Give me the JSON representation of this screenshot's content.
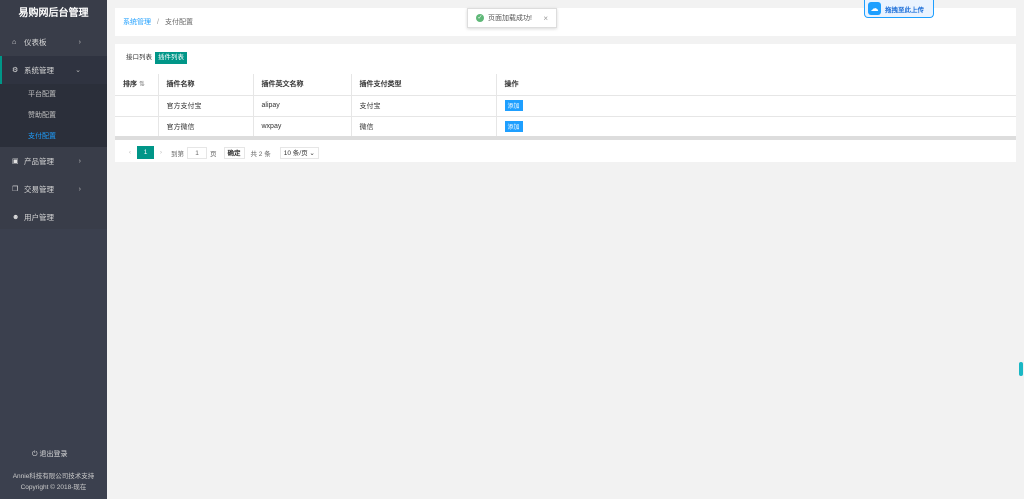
{
  "sidebar": {
    "brand": "易购网后台管理",
    "items": [
      {
        "label": "仪表板",
        "icon": "home-icon"
      },
      {
        "label": "系统管理",
        "icon": "gear-icon"
      },
      {
        "label": "产品管理",
        "icon": "product-icon"
      },
      {
        "label": "交易管理",
        "icon": "copy-icon"
      },
      {
        "label": "用户管理",
        "icon": "users-icon"
      }
    ],
    "submenu": [
      "平台配置",
      "赞助配置",
      "支付配置"
    ],
    "logout": "退出登录",
    "support": "Annie科技有限公司技术支持",
    "copyright": "Copyright © 2018-现在"
  },
  "breadcrumb": {
    "parent": "系统管理",
    "separator": "/",
    "current": "支付配置"
  },
  "toast": {
    "message": "页面加载成功!",
    "close": "×"
  },
  "upload": {
    "label": "拖拽至此上传"
  },
  "tabs": {
    "interface": "接口列表",
    "plugin": "插件列表"
  },
  "table": {
    "headers": {
      "sort": "排序",
      "name": "插件名称",
      "en": "插件英文名称",
      "type": "插件支付类型",
      "op": "操作"
    },
    "rows": [
      {
        "sort": "",
        "name": "官方支付宝",
        "en": "alipay",
        "type": "支付宝",
        "op": "添加"
      },
      {
        "sort": "",
        "name": "官方微信",
        "en": "wxpay",
        "type": "微信",
        "op": "添加"
      }
    ]
  },
  "pager": {
    "page": "1",
    "goto": "到第",
    "input": "1",
    "unit": "页",
    "confirm": "确定",
    "total": "共 2 条",
    "size": "10 条/页"
  },
  "colors": {
    "accent": "#009688",
    "blue": "#1e9fff",
    "sidebar": "#393d49"
  }
}
